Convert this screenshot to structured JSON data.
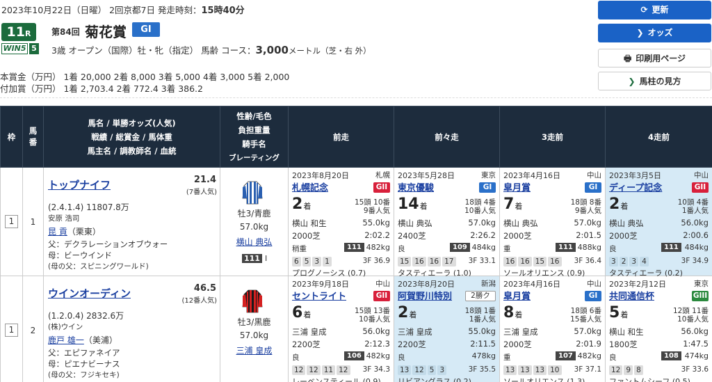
{
  "header": {
    "date_line": "2023年10月22日（日曜）  2回京都7日  発走時刻：",
    "post_time": "15時40分",
    "race_no": "11",
    "race_suffix": "R",
    "win5_label": "WIN5",
    "win5_no": "5",
    "ordinal": "第84回",
    "race_name": "菊花賞",
    "grade": "GI",
    "conditions_prefix": "3歳  オープン（国際）牡・牝（指定）  馬齢    コース：",
    "distance": "3,000",
    "conditions_suffix": "メートル（芝・右 外）",
    "prize_main": "本賞金（万円）   1着  20,000     2着    8,000     3着    5,000     4着    3,000     5着    2,000",
    "prize_add": "付加賞（万円）   1着  2,703.4    2着    772.4     3着    386.2"
  },
  "buttons": {
    "refresh": "更新",
    "odds": "オッズ",
    "print": "印刷用ページ",
    "guide": "馬柱の見方"
  },
  "table_header": {
    "waku": "枠",
    "umaban": "馬番",
    "horse_col": [
      "馬名 / 単勝オッズ(人気)",
      "戦績 / 総賞金 / 馬体重",
      "馬主名 / 調教師名 / 血統"
    ],
    "jockey_col": [
      "性齢/毛色",
      "負担重量",
      "騎手名",
      "ブレーティング"
    ],
    "past1": "前走",
    "past2": "前々走",
    "past3": "3走前",
    "past4": "4走前"
  },
  "horses": [
    {
      "waku": "1",
      "umaban": "1",
      "name": "トップナイフ",
      "odds": "21.4",
      "popularity": "(7番人気)",
      "record": "(2.4.1.4)  11807.8万",
      "owner": "安原 浩司",
      "trainer": "昆 貢",
      "trainer_loc": "（栗東）",
      "sire": "父：デクラレーションオブウォー",
      "dam": "母：ビーウインド",
      "damsire": "(母の父：スピニングワールド)",
      "sex_color": "牡3/青鹿",
      "weight": "57.0kg",
      "jockey": "横山 典弘",
      "rating_box": "111",
      "rating_mark": "I",
      "silks": {
        "base": "#ffffff",
        "stripe": "#2a5fb0",
        "sleeve": "#2a5fb0"
      },
      "past": [
        {
          "date": "2023年8月20日",
          "loc": "札幌",
          "race": "札幌記念",
          "grade": "GII",
          "grade_color": "red",
          "rank": "2",
          "field": "15頭 10番",
          "pop": "9番人気",
          "jockey": "横山 和生",
          "wt": "55.0kg",
          "dist": "2000芝",
          "time": "2:02.2",
          "cond": "稍重",
          "idx": "111",
          "bw": "482kg",
          "pass": [
            "6",
            "5",
            "3",
            "1"
          ],
          "f3": "3F 36.9",
          "winner": "プログノーシス (0.7)",
          "bg": false
        },
        {
          "date": "2023年5月28日",
          "loc": "東京",
          "race": "東京優駿",
          "grade": "GI",
          "grade_color": "blue",
          "rank": "14",
          "field": "18頭 4番",
          "pop": "10番人気",
          "jockey": "横山 典弘",
          "wt": "57.0kg",
          "dist": "2400芝",
          "time": "2:26.2",
          "cond": "良",
          "idx": "109",
          "bw": "484kg",
          "pass": [
            "15",
            "16",
            "16",
            "17"
          ],
          "f3": "3F 33.1",
          "winner": "タスティエーラ (1.0)",
          "bg": false
        },
        {
          "date": "2023年4月16日",
          "loc": "中山",
          "race": "皐月賞",
          "grade": "GI",
          "grade_color": "blue",
          "rank": "7",
          "field": "18頭 8番",
          "pop": "9番人気",
          "jockey": "横山 典弘",
          "wt": "57.0kg",
          "dist": "2000芝",
          "time": "2:01.5",
          "cond": "重",
          "idx": "111",
          "bw": "488kg",
          "pass": [
            "16",
            "16",
            "15",
            "16"
          ],
          "f3": "3F 36.4",
          "winner": "ソールオリエンス (0.9)",
          "bg": false
        },
        {
          "date": "2023年3月5日",
          "loc": "中山",
          "race": "ディープ記念",
          "grade": "GII",
          "grade_color": "red",
          "rank": "2",
          "field": "10頭 4番",
          "pop": "1番人気",
          "jockey": "横山 典弘",
          "wt": "56.0kg",
          "dist": "2000芝",
          "time": "2:00.6",
          "cond": "良",
          "idx": "111",
          "bw": "484kg",
          "pass": [
            "3",
            "2",
            "3",
            "4"
          ],
          "f3": "3F 34.9",
          "winner": "タスティエーラ (0.2)",
          "bg": true
        }
      ]
    },
    {
      "waku": "1",
      "umaban": "2",
      "name": "ウインオーディン",
      "odds": "46.5",
      "popularity": "(12番人気)",
      "record": "(1.2.0.4)  2832.6万",
      "owner": "(株)ウイン",
      "trainer": "鹿戸 雄一",
      "trainer_loc": "（美浦）",
      "sire": "父：エピファネイア",
      "dam": "母：ピエナビーナス",
      "damsire": "(母の父：フジキセキ)",
      "sex_color": "牡3/黒鹿",
      "weight": "57.0kg",
      "jockey": "三浦 皇成",
      "rating_box": "",
      "rating_mark": "",
      "silks": {
        "base": "#1a1a1a",
        "stripe": "#d42020",
        "sleeve": "#d42020"
      },
      "past": [
        {
          "date": "2023年9月18日",
          "loc": "中山",
          "race": "セントライト",
          "grade": "GII",
          "grade_color": "red",
          "rank": "6",
          "field": "15頭 13番",
          "pop": "10番人気",
          "jockey": "三浦 皇成",
          "wt": "56.0kg",
          "dist": "2200芝",
          "time": "2:12.3",
          "cond": "良",
          "idx": "106",
          "bw": "482kg",
          "pass": [
            "12",
            "12",
            "11",
            "12"
          ],
          "f3": "3F 34.3",
          "winner": "レーベンスティール (0.9)",
          "bg": false
        },
        {
          "date": "2023年8月20日",
          "loc": "新潟",
          "race": "阿賀野川特別",
          "grade": "2勝ク",
          "grade_color": "class",
          "rank": "2",
          "field": "18頭 1番",
          "pop": "1番人気",
          "jockey": "三浦 皇成",
          "wt": "55.0kg",
          "dist": "2200芝",
          "time": "2:11.5",
          "cond": "良",
          "idx": "",
          "bw": "478kg",
          "pass": [
            "13",
            "12",
            "5",
            "3"
          ],
          "f3": "3F 35.5",
          "winner": "リビアングラス (0.2)",
          "bg": true
        },
        {
          "date": "2023年4月16日",
          "loc": "中山",
          "race": "皐月賞",
          "grade": "GI",
          "grade_color": "blue",
          "rank": "8",
          "field": "18頭 6番",
          "pop": "15番人気",
          "jockey": "三浦 皇成",
          "wt": "57.0kg",
          "dist": "2000芝",
          "time": "2:01.9",
          "cond": "重",
          "idx": "107",
          "bw": "482kg",
          "pass": [
            "13",
            "13",
            "13",
            "10"
          ],
          "f3": "3F 37.1",
          "winner": "ソールオリエンス (1.3)",
          "bg": false
        },
        {
          "date": "2023年2月12日",
          "loc": "東京",
          "race": "共同通信杯",
          "grade": "GIII",
          "grade_color": "green",
          "rank": "5",
          "field": "12頭 11番",
          "pop": "10番人気",
          "jockey": "横山 和生",
          "wt": "56.0kg",
          "dist": "1800芝",
          "time": "1:47.5",
          "cond": "良",
          "idx": "108",
          "bw": "474kg",
          "pass": [
            "12",
            "9",
            "8"
          ],
          "f3": "3F 33.6",
          "winner": "ファントムシーフ (0.5)",
          "bg": false
        }
      ]
    }
  ]
}
